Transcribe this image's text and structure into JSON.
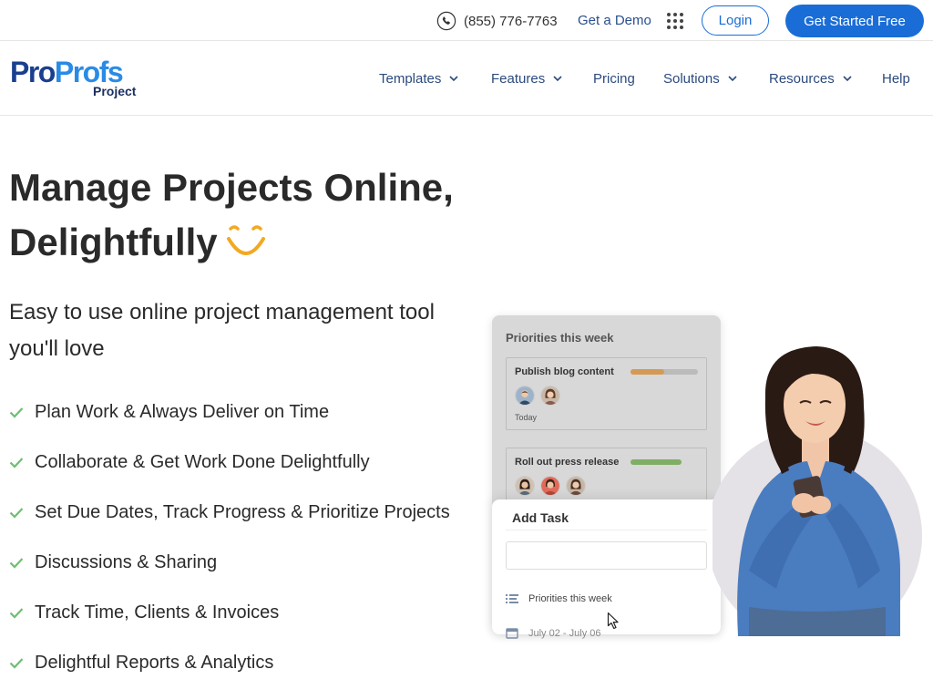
{
  "topbar": {
    "phone_icon": "phone-icon",
    "phone_number": "(855) 776-7763",
    "demo_label": "Get a Demo",
    "apps_icon": "grid-icon",
    "login_label": "Login",
    "start_label": "Get Started Free"
  },
  "brand": {
    "logo_part1": "Pro",
    "logo_part2": "Profs",
    "logo_sub": "Project"
  },
  "nav": {
    "items": [
      {
        "label": "Templates",
        "has_dropdown": true
      },
      {
        "label": "Features",
        "has_dropdown": true
      },
      {
        "label": "Pricing",
        "has_dropdown": false
      },
      {
        "label": "Solutions",
        "has_dropdown": true
      },
      {
        "label": "Resources",
        "has_dropdown": true
      },
      {
        "label": "Help",
        "has_dropdown": false
      }
    ]
  },
  "hero": {
    "title_line1": "Manage Projects Online,",
    "title_line2": "Delightfully",
    "subtitle": "Easy to use online project management tool you'll love",
    "features": [
      "Plan Work & Always Deliver on Time",
      "Collaborate & Get Work Done Delightfully",
      "Set Due Dates, Track Progress & Prioritize Projects",
      "Discussions & Sharing",
      "Track Time, Clients & Invoices",
      "Delightful Reports & Analytics"
    ]
  },
  "illustration": {
    "card_title": "Priorities this week",
    "tasks": [
      {
        "name": "Publish blog content",
        "due": "Today",
        "progress": 0.5,
        "color": "#d49a55"
      },
      {
        "name": "Roll out press release",
        "due": "",
        "progress": 1.0,
        "color": "#7fae65"
      }
    ],
    "add_task": {
      "title": "Add Task",
      "input_value": "",
      "list_label": "Priorities this week",
      "date_label": "July 02 - July 06"
    }
  },
  "colors": {
    "brand_blue": "#1a6dd6",
    "nav_text": "#2b4a7d",
    "check_green": "#6cc070",
    "smile_orange": "#f2a922"
  }
}
